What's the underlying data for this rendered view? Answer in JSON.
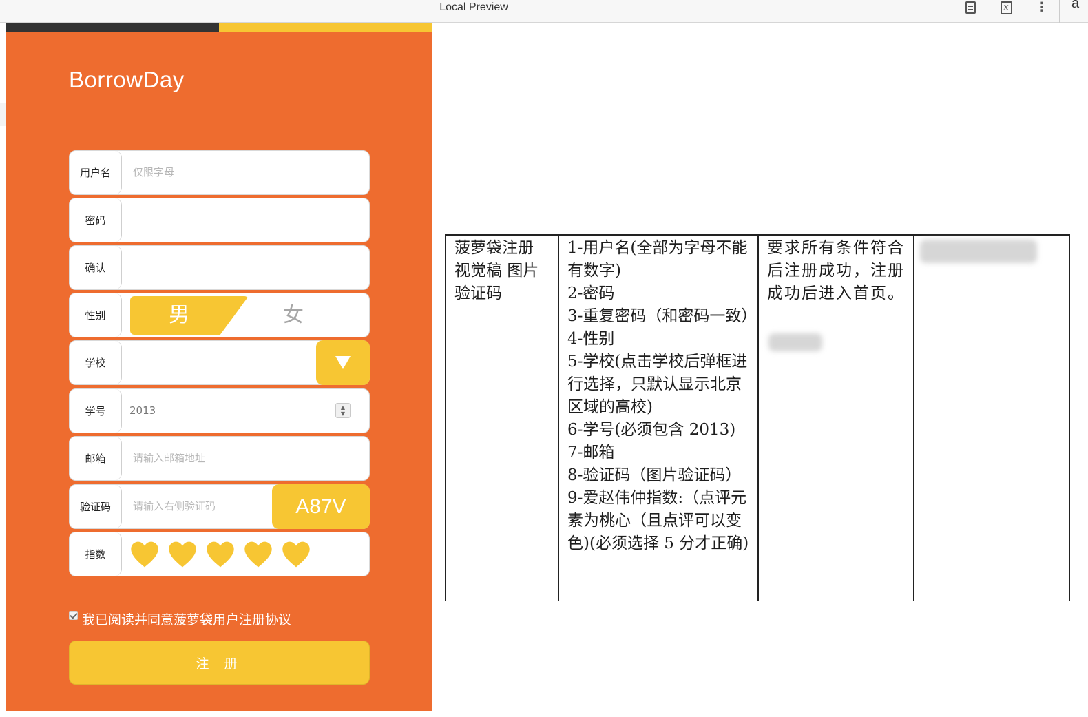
{
  "window": {
    "title": "Local Preview",
    "toolbar_icons": [
      "reader-mode-icon",
      "formula-icon",
      "more-vertical-icon",
      "font-a-icon"
    ],
    "partial_letter": "a"
  },
  "app": {
    "brand": "BorrowDay",
    "colors": {
      "background": "#ee6c2f",
      "accent": "#f7c633",
      "dark": "#333333"
    },
    "form": {
      "username": {
        "label": "用户名",
        "placeholder": "仅限字母"
      },
      "password": {
        "label": "密码"
      },
      "confirm": {
        "label": "确认"
      },
      "gender": {
        "label": "性别",
        "male": "男",
        "female": "女",
        "selected": "男"
      },
      "school": {
        "label": "学校",
        "button_icon": "dropdown-triangle-icon"
      },
      "student_id": {
        "label": "学号",
        "value": "2013"
      },
      "email": {
        "label": "邮箱",
        "placeholder": "请输入邮箱地址"
      },
      "captcha": {
        "label": "验证码",
        "placeholder": "请输入右侧验证码",
        "code": "A87V"
      },
      "rating": {
        "label": "指数",
        "hearts_total": 5,
        "hearts_selected": 5,
        "icon": "heart-icon"
      }
    },
    "agreement": {
      "text": "我已阅读并同意菠萝袋用户注册协议",
      "checked": true
    },
    "register_button": "注 册"
  },
  "requirements_table": {
    "col1": [
      "菠萝袋注册",
      "视觉稿",
      "图片验证码"
    ],
    "col2": [
      "1-用户名(全部为字母不能有数字)",
      "2-密码",
      "3-重复密码（和密码一致）",
      "4-性别",
      "5-学校(点击学校后弹框进行选择，只默认显示北京区域的高校)",
      "6-学号(必须包含 2013)",
      "7-邮箱",
      "8-验证码（图片验证码）",
      "9-爱赵伟仲指数:（点评元素为桃心（且点评可以变色)(必须选择 5 分才正确)"
    ],
    "col3": "要求所有条件符合后注册成功，注册成功后进入首页。"
  }
}
